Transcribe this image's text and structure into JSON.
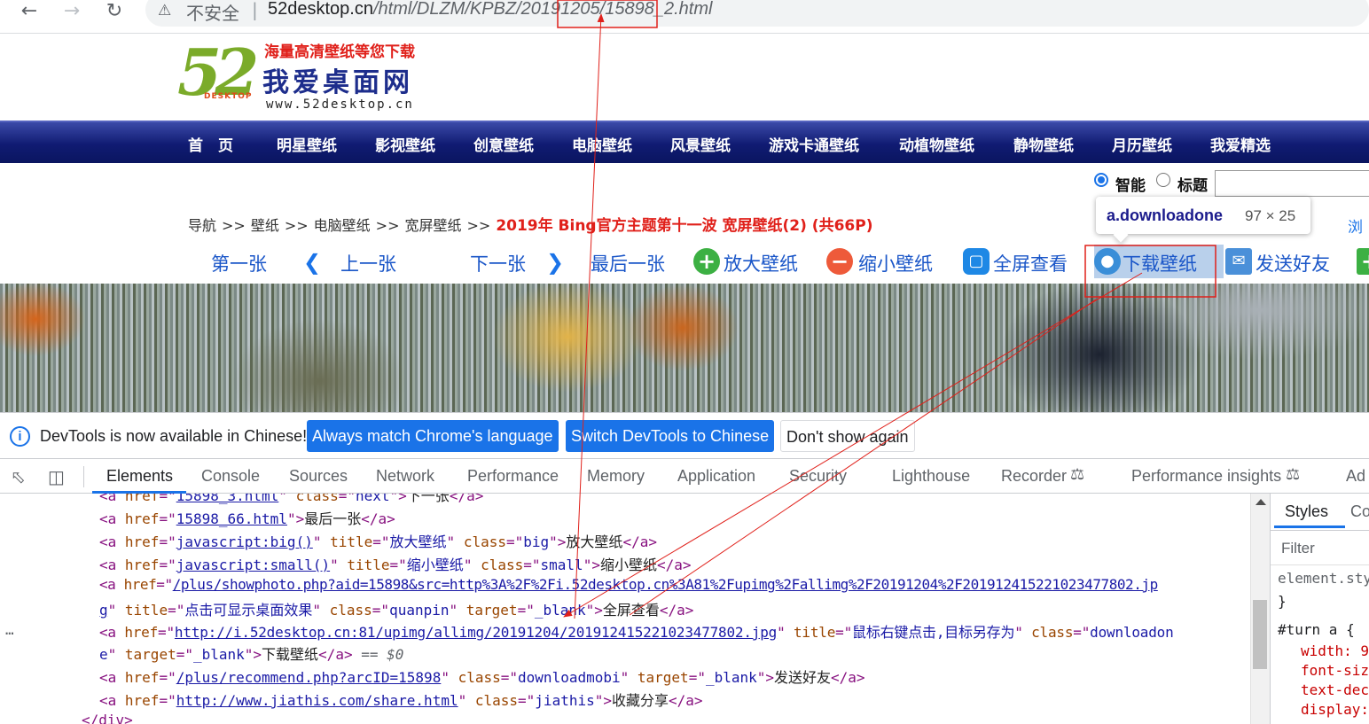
{
  "browser": {
    "insecure_label": "不安全",
    "separator": "|",
    "url_prefix": "52desktop.cn",
    "url_path": "/html/DLZM/KPBZ/20191205/15898_2.html"
  },
  "site": {
    "logo_digits": "52",
    "logo_desktop": "DESKTOP",
    "slogan": "海量高清壁纸等您下载",
    "name": "我爱桌面网",
    "domain": "www.52desktop.cn"
  },
  "nav": [
    "首　页",
    "明星壁纸",
    "影视壁纸",
    "创意壁纸",
    "电脑壁纸",
    "风景壁纸",
    "游戏卡通壁纸",
    "动植物壁纸",
    "静物壁纸",
    "月历壁纸",
    "我爱精选"
  ],
  "search": {
    "option_smart": "智能",
    "option_title": "标题"
  },
  "breadcrumb": {
    "items": [
      "导航",
      "壁纸",
      "电脑壁纸",
      "宽屏壁纸"
    ],
    "sep": ">>",
    "title": "2019年 Bing官方主题第十一波 宽屏壁纸(2) (共66P)",
    "browse_fragment": "浏"
  },
  "tooltip": {
    "selector": "a.downloadone",
    "dims": "97 × 25"
  },
  "toolbar": {
    "first": "第一张",
    "prev": "上一张",
    "next": "下一张",
    "last": "最后一张",
    "zoom_in": "放大壁纸",
    "zoom_out": "缩小壁纸",
    "fullscreen": "全屏查看",
    "download": "下载壁纸",
    "send": "发送好友"
  },
  "devtools": {
    "infobar": {
      "message": "DevTools is now available in Chinese!",
      "btn_match": "Always match Chrome's language",
      "btn_switch": "Switch DevTools to Chinese",
      "btn_dismiss": "Don't show again"
    },
    "tabs": [
      "Elements",
      "Console",
      "Sources",
      "Network",
      "Performance",
      "Memory",
      "Application",
      "Security",
      "Lighthouse",
      "Recorder",
      "Performance insights",
      "Ad"
    ],
    "code": {
      "l0_href": "15898_3.html",
      "l0_class": "next",
      "l0_text": "下一张",
      "l1_href": "15898_66.html",
      "l1_text": "最后一张",
      "l2_href": "javascript:big()",
      "l2_title": "放大壁纸",
      "l2_class": "big",
      "l2_text": "放大壁纸",
      "l3_href": "javascript:small()",
      "l3_title": "缩小壁纸",
      "l3_class": "small",
      "l3_text": "缩小壁纸",
      "l4_href_a": "/plus/showphoto.php?aid=15898&src=http%3A%2F%2Fi.52desktop.cn%3A81%2Fupimg%2Fallimg%2F20191204%2F201912415221023477802.jp",
      "l4_href_b": "g",
      "l4_title": "点击可显示桌面效果",
      "l4_class": "quanpin",
      "l4_target": "_blank",
      "l4_text": "全屏查看",
      "l5_href": "http://i.52desktop.cn:81/upimg/allimg/20191204/201912415221023477802.jpg",
      "l5_title": "鼠标右键点击,目标另存为",
      "l5_class_a": "downloadon",
      "l5_class_b": "e",
      "l5_target": "_blank",
      "l5_text": "下载壁纸",
      "l5_eq": "== $0",
      "l6_href": "/plus/recommend.php?arcID=15898",
      "l6_class": "downloadmobi",
      "l6_target": "_blank",
      "l6_text": "发送好友",
      "l7_href": "http://www.jiathis.com/share.html",
      "l7_class": "jiathis",
      "l7_text": "收藏分享",
      "l8": "</div>",
      "dots": "…"
    },
    "styles": {
      "tab_styles": "Styles",
      "tab_computed": "Co",
      "filter": "Filter",
      "rule1": "element.sty",
      "rule1_close": "}",
      "rule2": "#turn a {",
      "p1": "width: 9",
      "p2": "font-siz",
      "p3": "text-dec",
      "p4": "display:"
    }
  },
  "colors": {
    "annotation_red": "#e0201a",
    "devtools_blue": "#1a73e8",
    "nav_blue": "#101b72"
  }
}
